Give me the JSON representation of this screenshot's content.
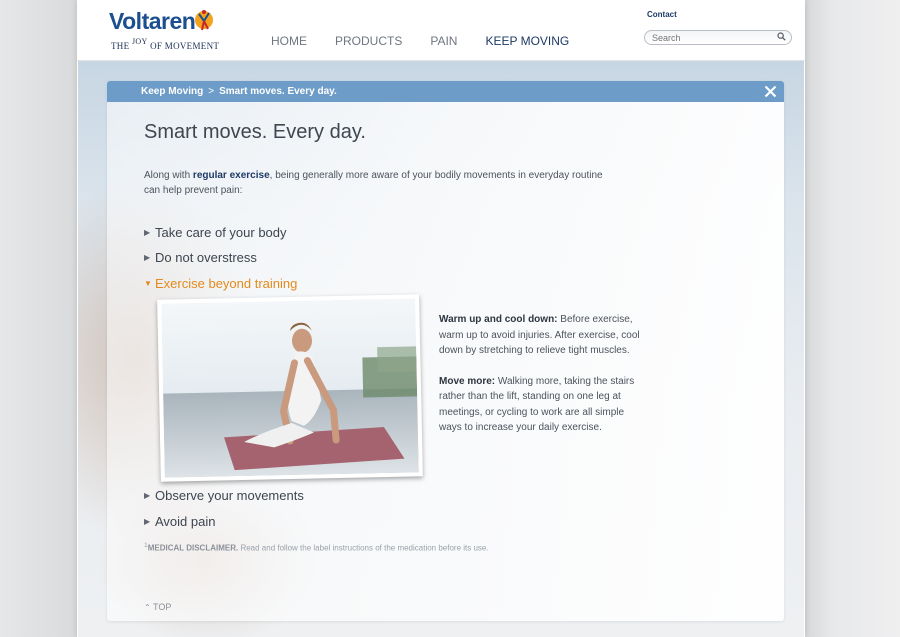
{
  "brand": {
    "name": "Voltaren",
    "tagline_pre": "THE",
    "tagline_joy": "JOY",
    "tagline_post": "OF MOVEMENT"
  },
  "header": {
    "contact": "Contact",
    "search_placeholder": "Search",
    "nav": [
      {
        "label": "HOME"
      },
      {
        "label": "PRODUCTS"
      },
      {
        "label": "PAIN"
      },
      {
        "label": "KEEP MOVING",
        "active": true
      }
    ]
  },
  "breadcrumb": {
    "section": "Keep Moving",
    "separator": ">",
    "current": "Smart moves. Every day."
  },
  "main": {
    "title": "Smart moves. Every day.",
    "intro_prefix": "Along with ",
    "intro_bold": "regular exercise",
    "intro_suffix": ", being generally more aware of your bodily movements in everyday routine can help prevent pain:",
    "accordion": [
      {
        "label": "Take care of your body",
        "open": false
      },
      {
        "label": "Do not overstress",
        "open": false
      },
      {
        "label": "Exercise beyond training",
        "open": true
      },
      {
        "label": "Observe your movements",
        "open": false
      },
      {
        "label": "Avoid pain",
        "open": false
      }
    ],
    "tips": [
      {
        "heading": "Warm up and cool down:",
        "text": " Before exercise, warm up to avoid injuries. After exercise, cool down by stretching to relieve tight muscles."
      },
      {
        "heading": "Move more:",
        "text": " Walking more, taking the stairs rather than the lift, standing on one leg at meetings, or cycling to work are all simple ways to increase your daily exercise."
      }
    ],
    "disclaimer_mark": "1",
    "disclaimer_title": "MEDICAL DISCLAIMER.",
    "disclaimer_text": " Read and follow the label instructions of the medication before its use.",
    "top_link": "TOP"
  },
  "colors": {
    "accent": "#e38a1c",
    "bar": "#6d9cc8",
    "brand": "#1b4f8f"
  }
}
